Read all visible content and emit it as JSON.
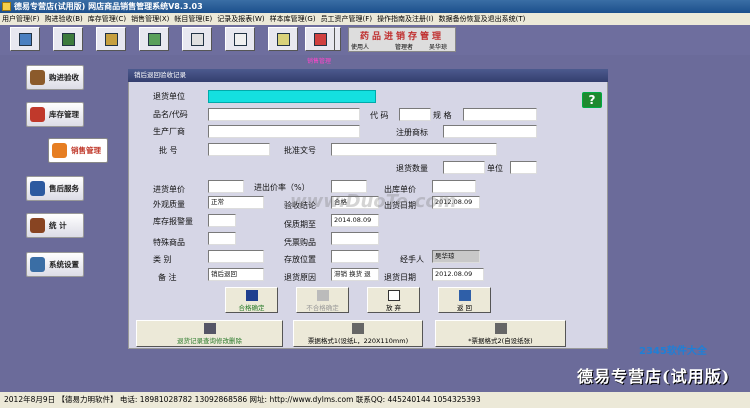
{
  "window": {
    "title": "德易专营店(试用版)  网店商品销售管理系统V8.3.03"
  },
  "menu": [
    "用户管理(F)",
    "购进验收(B)",
    "库存管理(C)",
    "销售管理(X)",
    "帐目管理(E)",
    "记录及报表(W)",
    "样本库管理(G)",
    "员工资产管理(F)",
    "操作指南及注册(I)",
    "数据备份恢复及退出系统(T)"
  ],
  "toolbar_icons": [
    "refresh-icon",
    "contract-icon",
    "search-doc-icon",
    "register-icon",
    "notepad-icon",
    "checklist-icon",
    "chart-icon",
    "id-card-icon",
    "exit-icon"
  ],
  "brand": {
    "title": "药品进销存管理",
    "user_label": "使用人",
    "role": "管理者",
    "name": "吴华琼"
  },
  "nav": [
    {
      "label": "购进验收"
    },
    {
      "label": "库存管理"
    },
    {
      "label": "销售管理"
    },
    {
      "label": "售后服务"
    },
    {
      "label": "统 计"
    },
    {
      "label": "系统设置"
    }
  ],
  "pink_text": "销售管理",
  "form": {
    "title": "销后退回验收记录",
    "labels": {
      "return_unit": "退货单位",
      "product": "品名/代码",
      "code": "代  码",
      "spec": "规  格",
      "manufacturer": "生产厂商",
      "trademark": "注册商标",
      "batch": "批    号",
      "approval": "批准文号",
      "qty": "退货数量",
      "unit": "单位",
      "purchase_price": "进货单价",
      "inout_ratio": "进出价率（%）",
      "out_price": "出库单价",
      "appearance": "外观质量",
      "conclusion": "验收结论",
      "out_date": "出货日期",
      "alert": "库存报警量",
      "expiry": "保质期至",
      "special": "特殊商品",
      "prescription": "凭票购品",
      "category": "类    别",
      "storage": "存放位置",
      "handler": "经手人",
      "remark": "备    注",
      "reason": "退货原因",
      "return_date": "退货日期"
    },
    "values": {
      "appearance": "正常",
      "conclusion": "合格",
      "out_date": "2012.08.09",
      "expiry": "2014.08.09",
      "handler": "吴华琼",
      "remark": "销后退回",
      "reason": "滞销 换货  退",
      "return_date": "2012.08.09"
    },
    "buttons": {
      "confirm": "合格确定",
      "reject": "不合格确定",
      "discard": "放  弃",
      "back": "返  回",
      "records": "退货记录查询修改删除",
      "print1": "票据格式1(设纸L，220X110mm)",
      "print2": "*票据格式2(自设纸张)"
    },
    "help": "?"
  },
  "watermark": "www.DuoTe.com",
  "corner": {
    "logo": "2345软件大全",
    "slogan": "德易专营店(试用版)"
  },
  "status": "2012年8月9日  【德易力明软件】  电话:   18981028782  13092868586  网址: http://www.dylms.com  联系QQ:  445240144   1054325393"
}
